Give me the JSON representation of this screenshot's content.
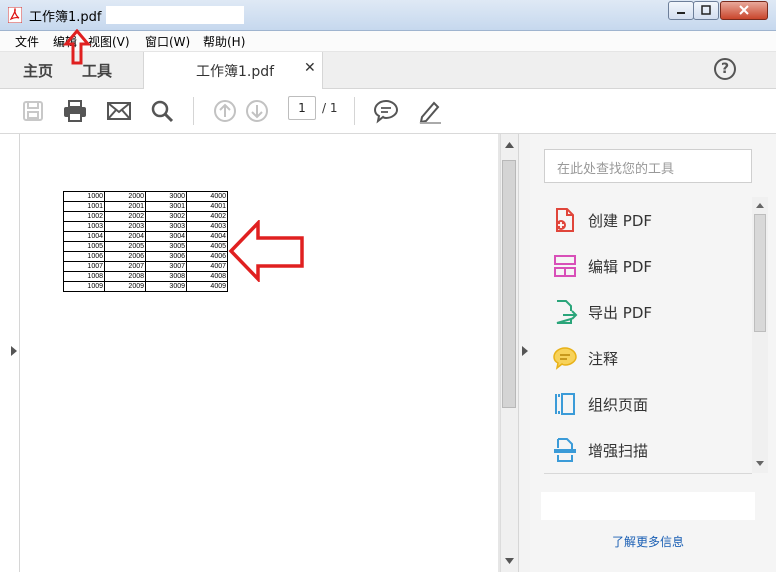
{
  "window": {
    "title": "工作簿1.pdf -"
  },
  "menu": [
    "文件",
    "编辑",
    "视图(V)",
    "窗口(W)",
    "帮助(H)"
  ],
  "tabs": {
    "home": "主页",
    "tools": "工具",
    "document": "工作簿1.pdf",
    "close_glyph": "✕",
    "help_glyph": "?"
  },
  "toolbar": {
    "icons": [
      "save-icon",
      "print-icon",
      "email-icon",
      "search-icon",
      "page-up-icon",
      "page-down-icon",
      "comment-icon",
      "pen-icon"
    ],
    "page_current": "1",
    "page_total": "/ 1"
  },
  "table_rows": [
    [
      "1000",
      "2000",
      "3000",
      "4000"
    ],
    [
      "1001",
      "2001",
      "3001",
      "4001"
    ],
    [
      "1002",
      "2002",
      "3002",
      "4002"
    ],
    [
      "1003",
      "2003",
      "3003",
      "4003"
    ],
    [
      "1004",
      "2004",
      "3004",
      "4004"
    ],
    [
      "1005",
      "2005",
      "3005",
      "4005"
    ],
    [
      "1006",
      "2006",
      "3006",
      "4006"
    ],
    [
      "1007",
      "2007",
      "3007",
      "4007"
    ],
    [
      "1008",
      "2008",
      "3008",
      "4008"
    ],
    [
      "1009",
      "2009",
      "3009",
      "4009"
    ]
  ],
  "right_panel": {
    "search_placeholder": "在此处查找您的工具",
    "tools": [
      {
        "label": "创建 PDF",
        "icon": "create-pdf-icon",
        "color": "#e0453a"
      },
      {
        "label": "编辑 PDF",
        "icon": "edit-pdf-icon",
        "color": "#d84fb8"
      },
      {
        "label": "导出 PDF",
        "icon": "export-pdf-icon",
        "color": "#2aa57a"
      },
      {
        "label": "注释",
        "icon": "comment-tool-icon",
        "color": "#e8b117"
      },
      {
        "label": "组织页面",
        "icon": "organize-pages-icon",
        "color": "#3b9bd8"
      },
      {
        "label": "增强扫描",
        "icon": "enhance-scan-icon",
        "color": "#3b9bd8"
      }
    ],
    "learn_more": "了解更多信息"
  },
  "colors": {
    "annotation_arrow": "#e02020",
    "accent_link": "#1a5fb4"
  }
}
